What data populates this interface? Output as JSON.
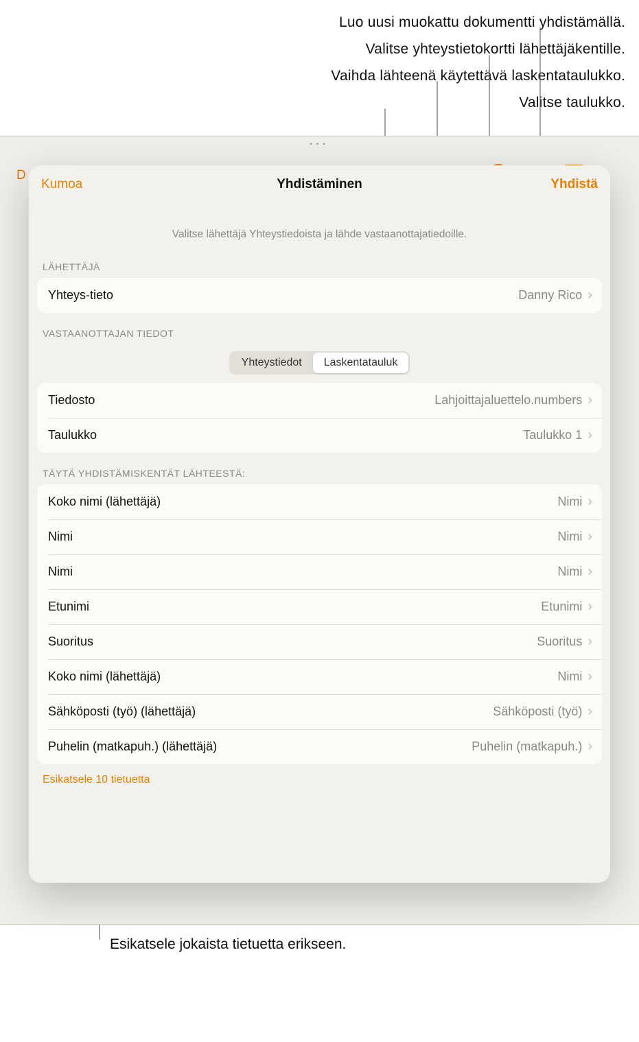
{
  "callouts": {
    "c1": "Luo uusi muokattu dokumentti yhdistämällä.",
    "c2": "Valitse yhteystietokortti lähettäjäkentille.",
    "c3": "Vaihda lähteenä käytettävä laskentataulukko.",
    "c4": "Valitse taulukko.",
    "bottom": "Esikatsele jokaista tietuetta erikseen."
  },
  "sheet": {
    "cancel": "Kumoa",
    "title": "Yhdistäminen",
    "merge": "Yhdistä",
    "subtitle": "Valitse lähettäjä Yhteystiedoista ja lähde vastaanottajatiedoille.",
    "from_label": "LÄHETTÄJÄ",
    "from_row_label": "Yhteys-tieto",
    "from_row_value": "Danny Rico",
    "recipient_label": "VASTAANOTTAJAN TIEDOT",
    "seg_contacts": "Yhteystiedot",
    "seg_spreadsheet": "Laskentatauluk",
    "file_label": "Tiedosto",
    "file_value": "Lahjoittajaluettelo.numbers",
    "table_label": "Taulukko",
    "table_value": "Taulukko 1",
    "populate_label": "TÄYTÄ YHDISTÄMISKENTÄT LÄHTEESTÄ:",
    "fields": [
      {
        "label": "Koko nimi (lähettäjä)",
        "value": "Nimi"
      },
      {
        "label": "Nimi",
        "value": "Nimi"
      },
      {
        "label": "Nimi",
        "value": "Nimi"
      },
      {
        "label": "Etunimi",
        "value": "Etunimi"
      },
      {
        "label": "Suoritus",
        "value": "Suoritus"
      },
      {
        "label": "Koko nimi (lähettäjä)",
        "value": "Nimi"
      },
      {
        "label": "Sähköposti (työ) (lähettäjä)",
        "value": "Sähköposti (työ)"
      },
      {
        "label": "Puhelin (matkapuh.) (lähettäjä)",
        "value": "Puhelin (matkapuh.)"
      }
    ],
    "preview_link": "Esikatsele 10 tietuetta"
  },
  "behind": {
    "documents": "D"
  }
}
